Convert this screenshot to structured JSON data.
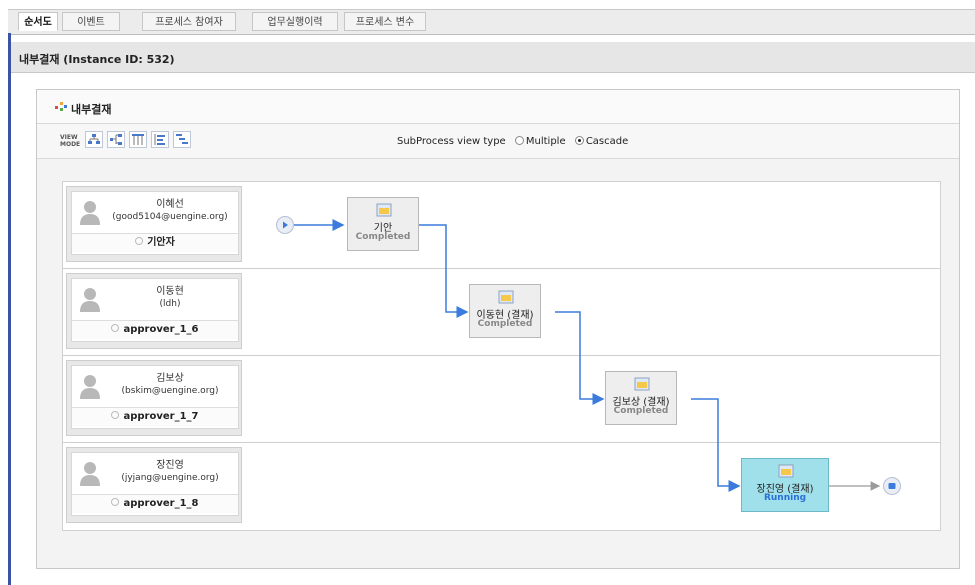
{
  "tabs": [
    {
      "label": "순서도",
      "active": true
    },
    {
      "label": "이벤트",
      "active": false
    },
    {
      "label": "프로세스 참여자",
      "active": false
    },
    {
      "label": "업무실행이력",
      "active": false
    },
    {
      "label": "프로세스 변수",
      "active": false
    }
  ],
  "header": {
    "title": "내부결재 (Instance ID: 532)"
  },
  "panel": {
    "title": "내부결재",
    "view_mode_label": "VIEW MODE",
    "view_buttons": [
      "view-tree-icon",
      "view-hierarchy-icon",
      "view-columns-icon",
      "view-list-icon",
      "view-indent-icon"
    ],
    "subprocess": {
      "label": "SubProcess view type",
      "options": [
        "Multiple",
        "Cascade"
      ],
      "selected": "Cascade"
    }
  },
  "lanes": [
    {
      "name": "이혜선",
      "email": "(good5104@uengine.org)",
      "role": "기안자"
    },
    {
      "name": "이동현",
      "email": "(ldh)",
      "role": "approver_1_6"
    },
    {
      "name": "김보상",
      "email": "(bskim@uengine.org)",
      "role": "approver_1_7"
    },
    {
      "name": "장진영",
      "email": "(jyjang@uengine.org)",
      "role": "approver_1_8"
    }
  ],
  "nodes": [
    {
      "label": "기안",
      "status": "Completed"
    },
    {
      "label": "이동현 (결재)",
      "status": "Completed"
    },
    {
      "label": "김보상 (결재)",
      "status": "Completed"
    },
    {
      "label": "장진영 (결재)",
      "status": "Running"
    }
  ],
  "colors": {
    "accent": "#3b53a5",
    "flow": "#3a7bdc",
    "running_bg": "#9fe0ea",
    "running_text": "#2b6fd6"
  }
}
